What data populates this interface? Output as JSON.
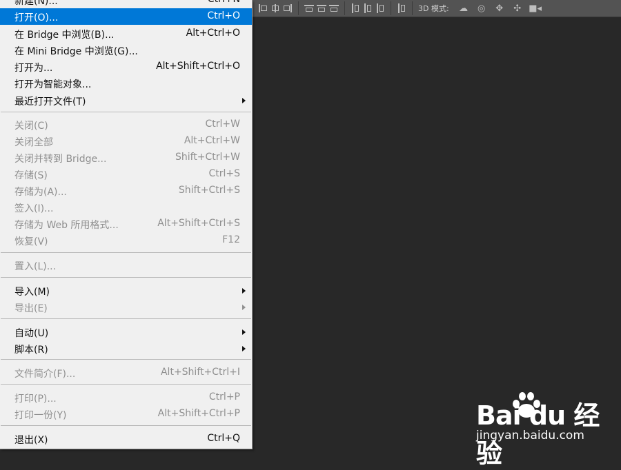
{
  "options_bar": {
    "mode_3d_label": "3D 模式:",
    "mode_3d_icons": [
      "rotate-3d-icon",
      "roll-3d-icon",
      "drag-3d-icon",
      "slide-3d-icon",
      "scale-3d-icon"
    ]
  },
  "menu": {
    "items": [
      {
        "label": "新建(N)...",
        "shortcut": "Ctrl+N",
        "enabled": true
      },
      {
        "label": "打开(O)...",
        "shortcut": "Ctrl+O",
        "enabled": true,
        "highlighted": true
      },
      {
        "label": "在 Bridge 中浏览(B)...",
        "shortcut": "Alt+Ctrl+O",
        "enabled": true
      },
      {
        "label": "在 Mini Bridge 中浏览(G)...",
        "shortcut": "",
        "enabled": true
      },
      {
        "label": "打开为...",
        "shortcut": "Alt+Shift+Ctrl+O",
        "enabled": true
      },
      {
        "label": "打开为智能对象...",
        "shortcut": "",
        "enabled": true
      },
      {
        "label": "最近打开文件(T)",
        "shortcut": "",
        "enabled": true,
        "submenu": true
      },
      {
        "label": "关闭(C)",
        "shortcut": "Ctrl+W",
        "enabled": false
      },
      {
        "label": "关闭全部",
        "shortcut": "Alt+Ctrl+W",
        "enabled": false
      },
      {
        "label": "关闭并转到 Bridge...",
        "shortcut": "Shift+Ctrl+W",
        "enabled": false
      },
      {
        "label": "存储(S)",
        "shortcut": "Ctrl+S",
        "enabled": false
      },
      {
        "label": "存储为(A)...",
        "shortcut": "Shift+Ctrl+S",
        "enabled": false
      },
      {
        "label": "签入(I)...",
        "shortcut": "",
        "enabled": false
      },
      {
        "label": "存储为 Web 所用格式...",
        "shortcut": "Alt+Shift+Ctrl+S",
        "enabled": false
      },
      {
        "label": "恢复(V)",
        "shortcut": "F12",
        "enabled": false
      },
      {
        "label": "置入(L)...",
        "shortcut": "",
        "enabled": false
      },
      {
        "label": "导入(M)",
        "shortcut": "",
        "enabled": true,
        "submenu": true
      },
      {
        "label": "导出(E)",
        "shortcut": "",
        "enabled": false,
        "submenu": true
      },
      {
        "label": "自动(U)",
        "shortcut": "",
        "enabled": true,
        "submenu": true
      },
      {
        "label": "脚本(R)",
        "shortcut": "",
        "enabled": true,
        "submenu": true
      },
      {
        "label": "文件简介(F)...",
        "shortcut": "Alt+Shift+Ctrl+I",
        "enabled": false
      },
      {
        "label": "打印(P)...",
        "shortcut": "Ctrl+P",
        "enabled": false
      },
      {
        "label": "打印一份(Y)",
        "shortcut": "Alt+Shift+Ctrl+P",
        "enabled": false
      },
      {
        "label": "退出(X)",
        "shortcut": "Ctrl+Q",
        "enabled": true
      }
    ]
  },
  "watermark": {
    "brand": "Bai du 经验",
    "url": "jingyan.baidu.com"
  },
  "colors": {
    "highlight": "#0078d7",
    "canvas": "#282828",
    "menu_bg": "#f0f0f0"
  }
}
